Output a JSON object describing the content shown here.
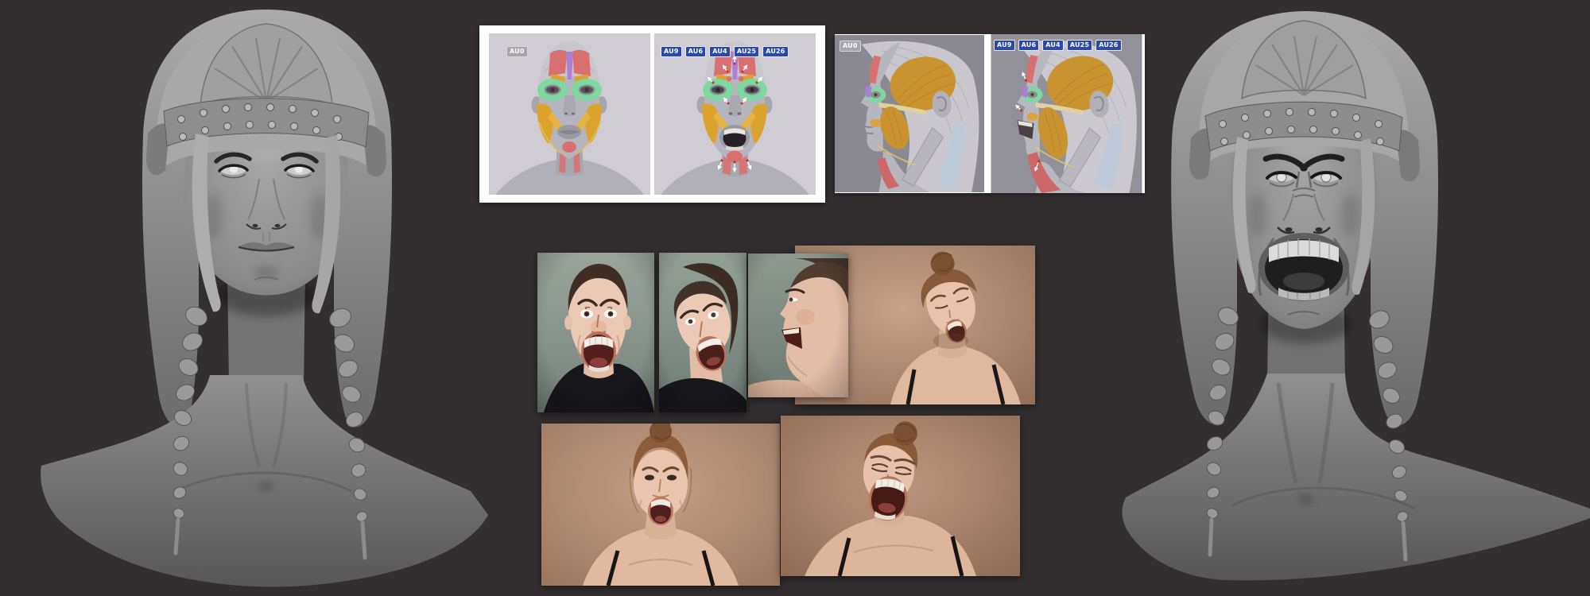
{
  "board": {
    "background": "#332f30",
    "content": "character-scream-expression-study-board"
  },
  "anatomy": {
    "neutral_label": "AU0",
    "au_labels": [
      "AU9",
      "AU6",
      "AU4",
      "AU25",
      "AU26"
    ],
    "colors": {
      "badge_blue": "#2b48ad",
      "badge_gray": "#a7a6ad",
      "front_panel_bg": "#cfccd4",
      "side_panel_bg_left": "#8a8992",
      "side_panel_bg_right": "#92919a",
      "frame": "#ffffff",
      "muscle_red": "#d97070",
      "muscle_green": "#7ed9a1",
      "muscle_ochre": "#c9932f",
      "muscle_yellow": "#dca22e",
      "muscle_purple": "#ad7fd2",
      "muscle_blue": "#b9c9da"
    }
  },
  "sculpts": {
    "left": "neutral-expression-bust",
    "right": "scream-expression-bust",
    "material_gray": "#8e8e8e"
  },
  "photos": {
    "row1": [
      "scream-front",
      "scream-three-quarter",
      "scream-profile",
      "scream-looking-down"
    ],
    "row2": [
      "scream-head-lowered",
      "scream-eyes-shut"
    ]
  }
}
